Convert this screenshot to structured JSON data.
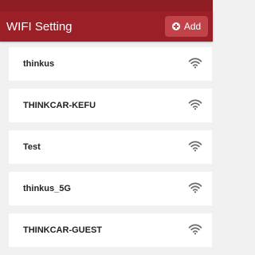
{
  "status_bar": {
    "left_text": "",
    "right_text": ""
  },
  "header": {
    "title": "WIFI Setting",
    "add_label": "Add"
  },
  "networks": [
    {
      "ssid": "thinkus",
      "icon": "wifi-icon"
    },
    {
      "ssid": "THINKCAR-KEFU",
      "icon": "wifi-icon"
    },
    {
      "ssid": "Test",
      "icon": "wifi-icon"
    },
    {
      "ssid": "thinkus_5G",
      "icon": "wifi-icon"
    },
    {
      "ssid": "THINKCAR-GUEST",
      "icon": "wifi-icon"
    }
  ],
  "colors": {
    "header": "#9b1f27",
    "status_bar": "#8e1d24",
    "add_button": "#c14249",
    "background": "#f1f1f1",
    "row": "#ffffff"
  }
}
